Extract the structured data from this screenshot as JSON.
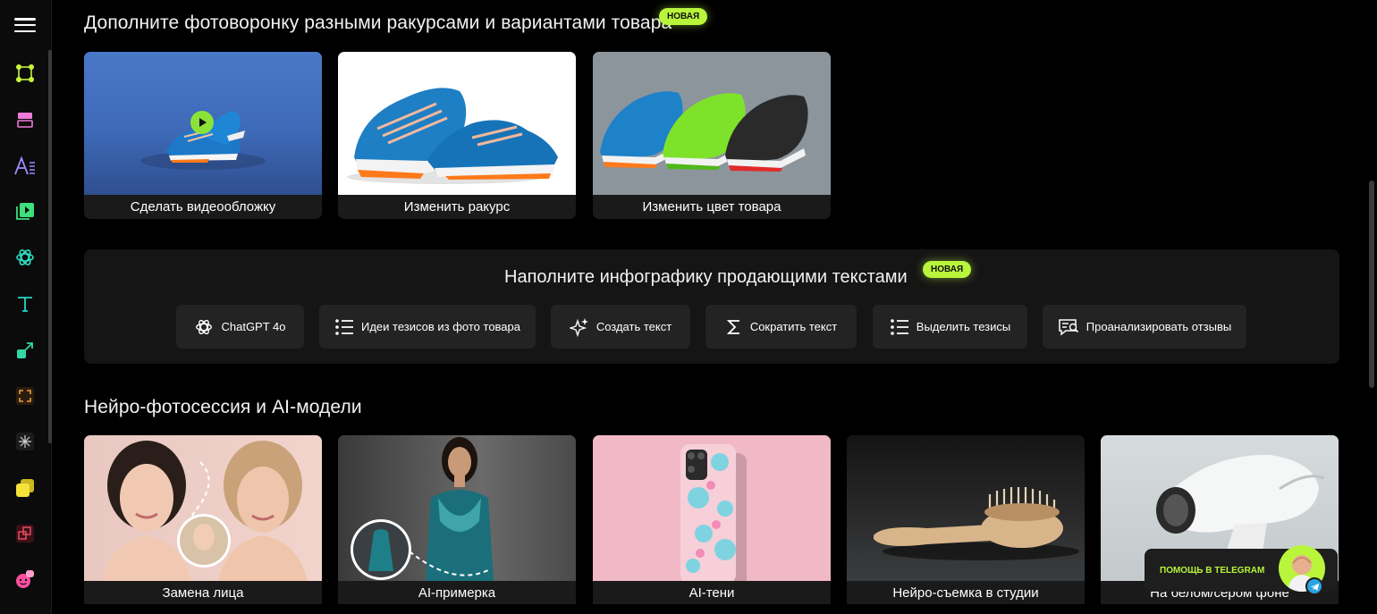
{
  "sidebar": {
    "menu_icon": "hamburger-menu-icon",
    "icons": [
      {
        "name": "crop-nodes-icon",
        "color": "#c8f53b"
      },
      {
        "name": "layout-card-icon",
        "color": "#f07ad9"
      },
      {
        "name": "text-format-icon",
        "color": "#9b8cff"
      },
      {
        "name": "video-play-icon",
        "color": "#3ee07a"
      },
      {
        "name": "openai-icon",
        "color": "#2ee0c4"
      },
      {
        "name": "text-tool-icon",
        "color": "#28d6c8"
      },
      {
        "name": "resize-arrow-icon",
        "color": "#35d6a5"
      },
      {
        "name": "expand-frame-icon",
        "color": "#f09a3a"
      },
      {
        "name": "sparkle-compass-icon",
        "color": "#cfcfcf"
      },
      {
        "name": "layers-icon",
        "color": "#f5e23b"
      },
      {
        "name": "transform-icon",
        "color": "#e84a5f"
      },
      {
        "name": "emoji-chat-icon",
        "color": "#ff4fa0"
      }
    ]
  },
  "section1": {
    "title": "Дополните фотоворонку разными ракурсами и вариантами товара",
    "badge": "НОВАЯ",
    "cards": [
      {
        "label": "Сделать видеообложку"
      },
      {
        "label": "Изменить ракурс"
      },
      {
        "label": "Изменить цвет товара"
      }
    ]
  },
  "infographic": {
    "title": "Наполните инфографику продающими текстами",
    "badge": "НОВАЯ",
    "buttons": [
      {
        "label": "ChatGPT 4o",
        "icon": "openai-icon"
      },
      {
        "label": "Идеи тезисов из фото товара",
        "icon": "list-icon"
      },
      {
        "label": "Создать текст",
        "icon": "sparkles-icon"
      },
      {
        "label": "Сократить текст",
        "icon": "sigma-icon"
      },
      {
        "label": "Выделить тезисы",
        "icon": "list-icon"
      },
      {
        "label": "Проанализировать отзывы",
        "icon": "review-analyze-icon"
      }
    ]
  },
  "section3": {
    "title": "Нейро-фотосессия и AI-модели",
    "cards": [
      {
        "label": "Замена лица"
      },
      {
        "label": "AI-примерка"
      },
      {
        "label": "AI-тени"
      },
      {
        "label": "Нейро-съемка в студии"
      },
      {
        "label": "На белом/сером фоне"
      }
    ]
  },
  "telegram": {
    "label": "ПОМОЩЬ В TELEGRAM",
    "icon": "telegram-icon"
  },
  "colors": {
    "accent": "#b9f53b",
    "background": "#000000",
    "card": "#1a1a1a"
  }
}
